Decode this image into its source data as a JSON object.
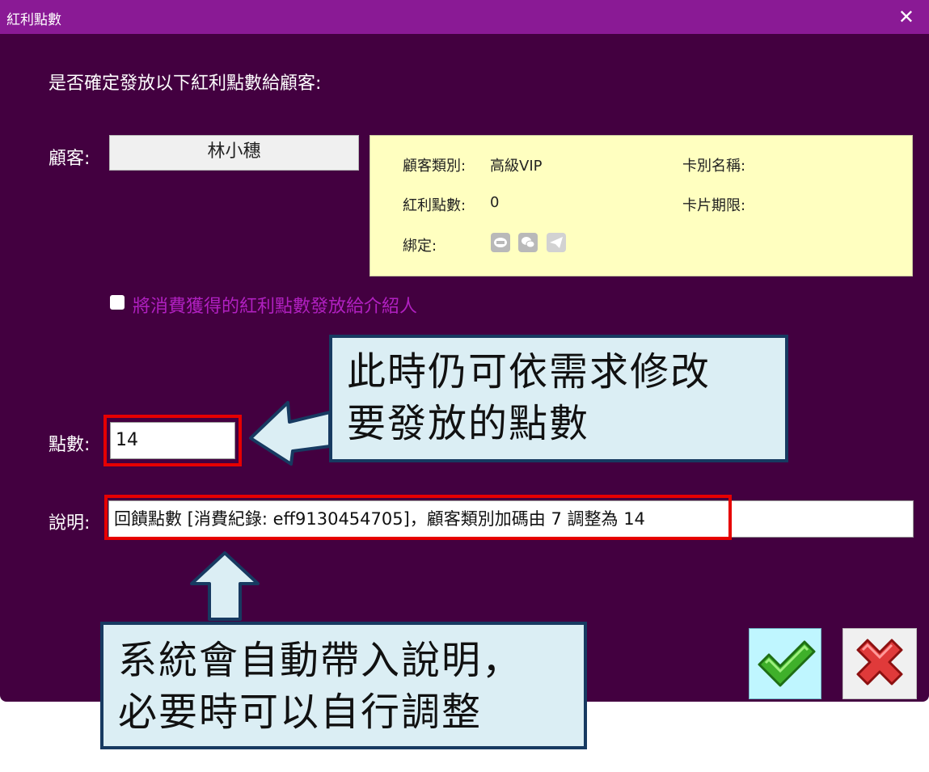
{
  "window": {
    "title": "紅利點數",
    "close_symbol": "✕"
  },
  "prompt": "是否確定發放以下紅利點數給顧客:",
  "customer": {
    "label": "顧客:",
    "name": "林小穗"
  },
  "info_panel": {
    "category_key": "顧客類別:",
    "category_value": "高級VIP",
    "points_key": "紅利點數:",
    "points_value": "0",
    "binding_key": "綁定:",
    "card_name_key": "卡別名稱:",
    "card_expiry_key": "卡片期限:",
    "binding_icons": [
      "line-icon",
      "wechat-icon",
      "telegram-icon"
    ]
  },
  "referrer_checkbox": {
    "label": "將消費獲得的紅利點數發放給介紹人",
    "checked": false
  },
  "points": {
    "label": "點數:",
    "value": "14"
  },
  "description": {
    "label": "說明:",
    "value": "回饋點數 [消費紀錄: eff9130454705]，顧客類別加碼由 7 調整為 14"
  },
  "callouts": {
    "points_line1": "此時仍可依需求修改",
    "points_line2": "要發放的點數",
    "desc_line1": "系統會自動帶入說明，",
    "desc_line2": "必要時可以自行調整"
  },
  "buttons": {
    "ok": "confirm",
    "cancel": "cancel"
  },
  "colors": {
    "titlebar": "#8a1a95",
    "dialog_bg": "#430040",
    "info_panel_bg": "#ffffc0",
    "highlight_frame": "#e60000",
    "callout_bg": "#dbeef4",
    "callout_border": "#173a61",
    "checkbox_label": "#b020c0"
  }
}
